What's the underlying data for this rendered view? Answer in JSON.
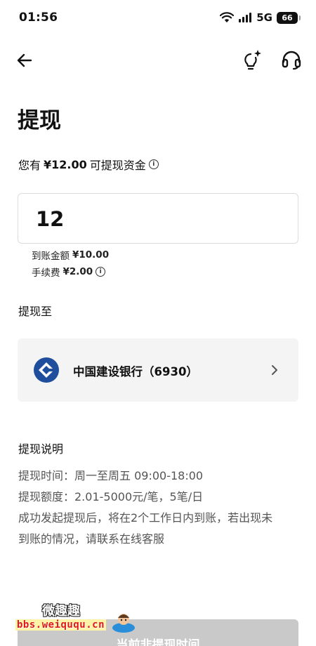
{
  "status_bar": {
    "time": "01:56",
    "network": "5G",
    "battery": "66"
  },
  "nav": {},
  "page": {
    "title": "提现"
  },
  "balance": {
    "prefix": "您有",
    "amount": "¥12.00",
    "suffix": "可提现资金"
  },
  "amount_input": {
    "value": "12"
  },
  "breakdown": {
    "arrival_label": "到账金额",
    "arrival_value": "¥10.00",
    "fee_label": "手续费",
    "fee_value": "¥2.00"
  },
  "withdraw_to": {
    "label": "提现至"
  },
  "bank": {
    "name": "中国建设银行（6930）",
    "logo_color": "#1f4e9c"
  },
  "description": {
    "title": "提现说明",
    "lines": [
      "提现时间：周一至周五 09:00-18:00",
      "提现额度：2.01-5000元/笔，5笔/日",
      "成功发起提现后，将在2个工作日内到账，若出现未",
      "到账的情况，请联系在线客服"
    ]
  },
  "submit": {
    "label": "当前非提现时间"
  },
  "watermark": {
    "text_cn": "微趣趣",
    "url": "bbs.weiququ.cn"
  }
}
